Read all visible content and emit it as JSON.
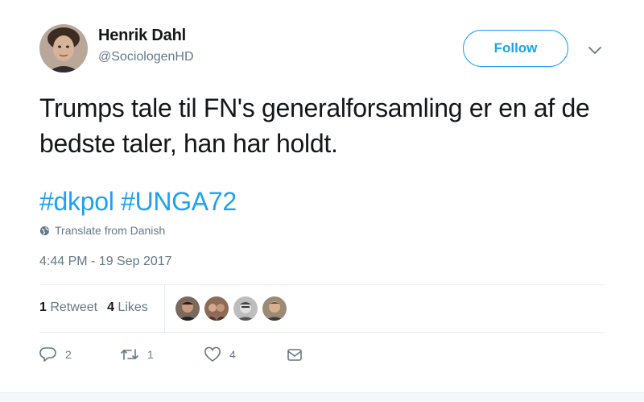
{
  "author": {
    "name": "Henrik Dahl",
    "handle": "@SociologenHD"
  },
  "follow_label": "Follow",
  "tweet": {
    "text": "Trumps tale til FN's generalforsamling er en af de bedste taler, han har holdt.",
    "hashtags": [
      "#dkpol",
      "#UNGA72"
    ],
    "translate_label": "Translate from Danish",
    "timestamp": "4:44 PM - 19 Sep 2017"
  },
  "stats": {
    "retweets_count": "1",
    "retweets_label": "Retweet",
    "likes_count": "4",
    "likes_label": "Likes"
  },
  "actions": {
    "reply_count": "2",
    "retweet_count": "1",
    "like_count": "4"
  },
  "colors": {
    "accent": "#1da1f2",
    "muted": "#657786",
    "text": "#14171a",
    "divider": "#e6ecf0"
  },
  "icons": [
    "chevron-down-icon",
    "globe-icon",
    "reply-icon",
    "retweet-icon",
    "heart-icon",
    "envelope-icon"
  ]
}
